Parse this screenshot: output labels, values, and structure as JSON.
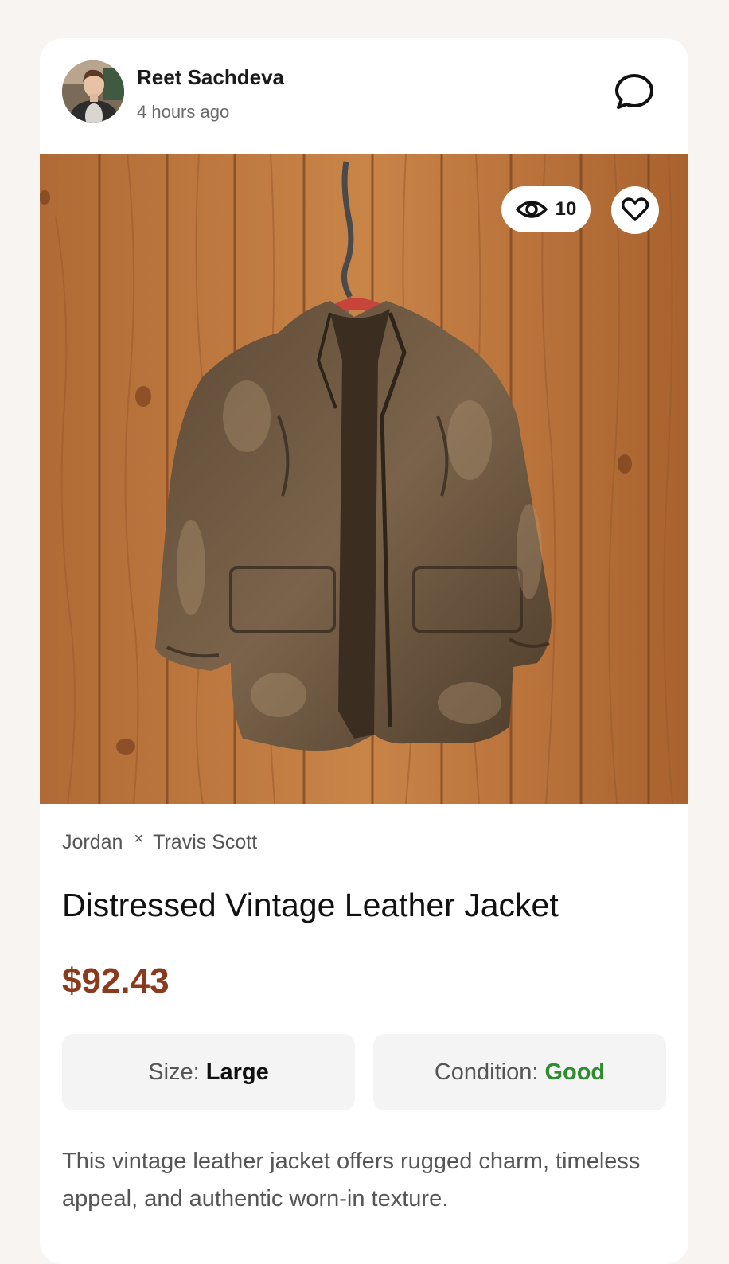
{
  "post": {
    "user_name": "Reet Sachdeva",
    "time_ago": "4 hours ago",
    "chat_icon": "chat-bubble-icon"
  },
  "image": {
    "view_icon": "eye-icon",
    "view_count": "10",
    "like_icon": "heart-icon"
  },
  "product": {
    "brand_1": "Jordan",
    "brand_separator": "×",
    "brand_2": "Travis Scott",
    "title": "Distressed Vintage Leather Jacket",
    "price": "$92.43",
    "price_color": "#8b3a1e",
    "size_label": "Size:",
    "size_value": "Large",
    "condition_label": "Condition:",
    "condition_value": "Good",
    "condition_color": "#2e8b2e",
    "description": "This vintage leather jacket offers rugged charm, timeless appeal, and authentic worn-in texture."
  }
}
